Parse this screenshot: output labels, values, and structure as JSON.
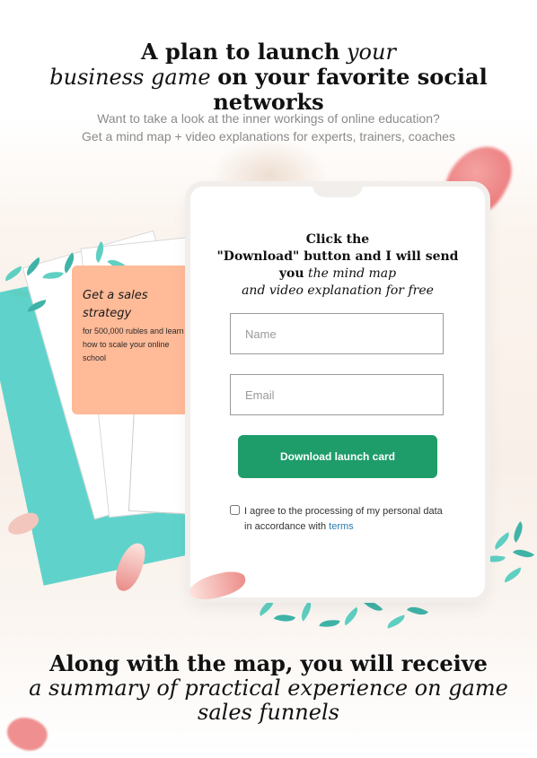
{
  "hero": {
    "title_bold_1": "A plan to launch",
    "title_italic_1": "your",
    "title_italic_2": "business game",
    "title_bold_2": "on your favorite social networks"
  },
  "subtitle": {
    "line1": "Want to take a look at the inner workings of online education?",
    "line2": "Get a mind map + video explanations for experts, trainers, coaches"
  },
  "promo_card": {
    "title": "Get a sales strategy",
    "text": "for 500,000 rubles and learn how to scale your online school"
  },
  "form": {
    "heading_line1": "Click the",
    "heading_line2": "\"Download\" button and I will send",
    "heading_bold_3": "you",
    "heading_italic_3": "the mind map",
    "heading_italic_4": "and video explanation for free",
    "name_placeholder": "Name",
    "name_value": "",
    "email_placeholder": "Email",
    "email_value": "",
    "button_label": "Download launch card",
    "consent_text": "I agree to the processing of my personal data in accordance with",
    "consent_link": "terms",
    "consent_checked": false
  },
  "bottom": {
    "title_bold": "Along with the map, you will receive",
    "title_italic": "a summary of practical experience on game sales funnels"
  },
  "colors": {
    "accent_green": "#1e9c6a",
    "promo_peach": "#ffba98",
    "teal": "#5fd3cb",
    "link_blue": "#2b7bb0"
  },
  "icons": [
    "checkbox-icon"
  ]
}
